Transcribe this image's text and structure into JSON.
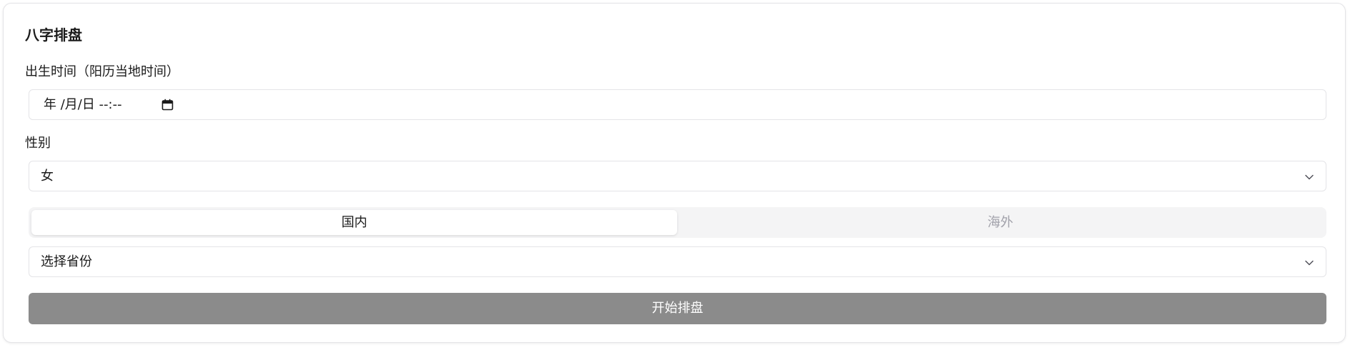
{
  "form": {
    "title": "八字排盘",
    "birth_label": "出生时间（阳历当地时间）",
    "birth_value": "年 /月/日 --:--",
    "gender_label": "性别",
    "gender_value": "女",
    "region_tabs": [
      {
        "label": "国内",
        "active": true
      },
      {
        "label": "海外",
        "active": false
      }
    ],
    "province_placeholder": "选择省份",
    "submit_label": "开始排盘"
  },
  "icons": {
    "calendar": "calendar-icon",
    "chevron": "chevron-down-icon"
  },
  "colors": {
    "submit_disabled_bg": "#8b8b8b",
    "border": "#e4e4e7",
    "segment_bg": "#f4f4f5",
    "inactive_text": "#a1a1aa"
  }
}
